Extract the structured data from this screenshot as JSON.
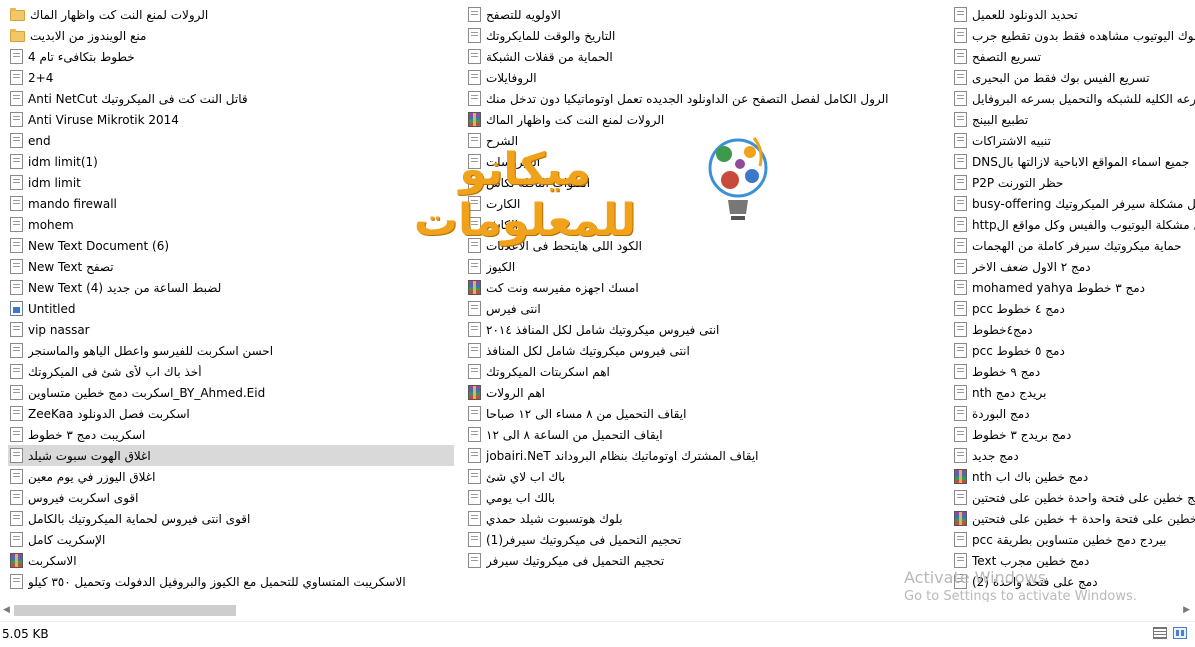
{
  "files": {
    "columns": [
      [
        {
          "name": "الرولات لمنع النت كت واظهار الماك",
          "icon": "folder-icon"
        },
        {
          "name": "منع الويندوز من الابديت",
          "icon": "folder-icon"
        },
        {
          "name": "خطوط بتكافىء تام 4",
          "icon": "text-file-icon"
        },
        {
          "name": "2+4",
          "icon": "text-file-icon"
        },
        {
          "name": "Anti NetCut قاتل النت كت فى الميكروتيك",
          "icon": "text-file-icon"
        },
        {
          "name": "Anti Viruse Mikrotik 2014",
          "icon": "text-file-icon"
        },
        {
          "name": "end",
          "icon": "text-file-icon"
        },
        {
          "name": "idm limit(1)",
          "icon": "text-file-icon"
        },
        {
          "name": "idm limit",
          "icon": "text-file-icon"
        },
        {
          "name": "mando firewall",
          "icon": "text-file-icon"
        },
        {
          "name": "mohem",
          "icon": "text-file-icon"
        },
        {
          "name": "New Text Document (6)",
          "icon": "text-file-icon"
        },
        {
          "name": "New Text تصفح",
          "icon": "text-file-icon"
        },
        {
          "name": "New Text لضبط الساعة من جديد (4)",
          "icon": "text-file-icon"
        },
        {
          "name": "Untitled",
          "icon": "image-file-icon"
        },
        {
          "name": "vip nassar",
          "icon": "text-file-icon"
        },
        {
          "name": "احسن اسكربت للفيرسو واعطل الياهو والماسنجر",
          "icon": "text-file-icon"
        },
        {
          "name": "أخذ باك اب لأى شئ فى الميكروتك",
          "icon": "text-file-icon"
        },
        {
          "name": "اسكربت دمج خطين متساوين_BY_Ahmed.Eid",
          "icon": "text-file-icon"
        },
        {
          "name": "ZeeKaa  اسكربت فصل الدونلود",
          "icon": "text-file-icon"
        },
        {
          "name": "اسكريبت دمج ٣ خطوط",
          "icon": "text-file-icon"
        },
        {
          "name": "اغلاق الهوت سبوت شيلد",
          "icon": "text-file-icon",
          "selected": true
        },
        {
          "name": "اغلاق اليوزر في يوم معين",
          "icon": "text-file-icon"
        },
        {
          "name": "اقوى اسكربت فيروس",
          "icon": "text-file-icon"
        },
        {
          "name": "اقوى انتى فيروس لحماية الميكروتيك بالكامل",
          "icon": "text-file-icon"
        },
        {
          "name": "الإسكريت كامل",
          "icon": "text-file-icon"
        },
        {
          "name": "الاسكربت",
          "icon": "rar-archive-icon"
        },
        {
          "name": "الاسكريبت المتساوي للتحميل مع الكيوز والبروفيل الدفولت وتحميل ٣٥٠ كيلو",
          "icon": "text-file-icon"
        }
      ],
      [
        {
          "name": "الاولويه للتصفح",
          "icon": "text-file-icon"
        },
        {
          "name": "التاريخ والوقت للمايكروتك",
          "icon": "text-file-icon"
        },
        {
          "name": "الحماية من قفلات الشبكة",
          "icon": "text-file-icon"
        },
        {
          "name": "الروفايلات",
          "icon": "text-file-icon"
        },
        {
          "name": "الرول الكامل لفصل التصفح عن الداونلود الجديده تعمل اوتوماتيكيا دون تدخل منك",
          "icon": "text-file-icon"
        },
        {
          "name": "الرولات لمنع النت كت واظهار الماك",
          "icon": "rar-archive-icon"
        },
        {
          "name": "الشرح",
          "icon": "text-file-icon"
        },
        {
          "name": "الفيروسات",
          "icon": "text-file-icon"
        },
        {
          "name": "القنوات الناقله لكاس",
          "icon": "text-file-icon"
        },
        {
          "name": "الكارت",
          "icon": "text-file-icon"
        },
        {
          "name": "الكاش",
          "icon": "text-file-icon"
        },
        {
          "name": "الكود اللى هايتحط فى الاعلانات",
          "icon": "text-file-icon"
        },
        {
          "name": "الكيوز",
          "icon": "text-file-icon"
        },
        {
          "name": "امسك اجهزه مفيرسه ونت كت",
          "icon": "rar-archive-icon"
        },
        {
          "name": "انتى فيرس",
          "icon": "text-file-icon"
        },
        {
          "name": "انتى فيروس ميكروتيك شامل لكل المنافذ ٢٠١٤",
          "icon": "text-file-icon"
        },
        {
          "name": "انتى فيروس ميكروتيك شامل لكل المنافذ",
          "icon": "text-file-icon"
        },
        {
          "name": "اهم  اسكربتات  الميكروتك",
          "icon": "text-file-icon"
        },
        {
          "name": "اهم الرولات",
          "icon": "rar-archive-icon"
        },
        {
          "name": "ايقاف التحميل من ٨ مساء الى ١٢ صباحا",
          "icon": "text-file-icon"
        },
        {
          "name": "ايقاف التحميل من الساعة ٨ الى ١٢",
          "icon": "text-file-icon"
        },
        {
          "name": "jobairi.NeT ايقاف المشترك اوتوماتيك بنظام البروداند",
          "icon": "text-file-icon"
        },
        {
          "name": "باك اب لاي شئ",
          "icon": "text-file-icon"
        },
        {
          "name": "بالك اب يومي",
          "icon": "text-file-icon"
        },
        {
          "name": "بلوك هوتسبوت شيلد حمدي",
          "icon": "text-file-icon"
        },
        {
          "name": "(1)تحجيم التحميل فى ميكروتيك سيرفر",
          "icon": "text-file-icon"
        },
        {
          "name": "تحجيم التحميل فى ميكروتيك سيرفر",
          "icon": "text-file-icon"
        }
      ],
      [
        {
          "name": "تحديد الدونلود للعميل",
          "icon": "text-file-icon"
        },
        {
          "name": "بوك اليوتيوب مشاهده فقط بدون تقطيع جرب",
          "icon": "text-file-icon"
        },
        {
          "name": "تسريع التصفح",
          "icon": "text-file-icon"
        },
        {
          "name": "تسريع الفيس بوك فقط من البحيرى",
          "icon": "text-file-icon"
        },
        {
          "name": "السرعه الكليه للشبكه والتحميل بسرعه البروفايل",
          "icon": "text-file-icon"
        },
        {
          "name": "تطبيع البينج",
          "icon": "text-file-icon"
        },
        {
          "name": "تنبيه الاشتراكات",
          "icon": "text-file-icon"
        },
        {
          "name": "DNSجميع اسماء المواقع الاباحية لازالتها بال",
          "icon": "text-file-icon"
        },
        {
          "name": "P2P حظر التورنت",
          "icon": "text-file-icon"
        },
        {
          "name": "busy-offering حل مشكلة سيرفر الميكروتيك",
          "icon": "text-file-icon"
        },
        {
          "name": "httpحل مشكلة اليوتيوب والفيس وكل مواقع ال",
          "icon": "text-file-icon"
        },
        {
          "name": "حماية ميكروتيك سيرفر كاملة من الهجمات",
          "icon": "text-file-icon"
        },
        {
          "name": "دمج ٢ الاول ضعف الاخر",
          "icon": "text-file-icon"
        },
        {
          "name": "mohamed yahya دمج ٣ خطوط",
          "icon": "text-file-icon"
        },
        {
          "name": "pcc دمج ٤ خطوط",
          "icon": "text-file-icon"
        },
        {
          "name": "دمج٤خطوط",
          "icon": "text-file-icon"
        },
        {
          "name": "pcc دمج ٥ خطوط",
          "icon": "text-file-icon"
        },
        {
          "name": "دمج ٩ خطوط",
          "icon": "text-file-icon"
        },
        {
          "name": "nth بريدج دمج",
          "icon": "text-file-icon"
        },
        {
          "name": "دمج البوردة",
          "icon": "text-file-icon"
        },
        {
          "name": "دمج بريدج ٣ خطوط",
          "icon": "text-file-icon"
        },
        {
          "name": "دمج جديد",
          "icon": "text-file-icon"
        },
        {
          "name": "nth دمج خطين  باك اب",
          "icon": "rar-archive-icon"
        },
        {
          "name": "دمج خطين على فتحة واحدة  خطين على فتحتين",
          "icon": "text-file-icon"
        },
        {
          "name": "دمج خطين على فتحة واحدة + خطين على فتحتين",
          "icon": "rar-archive-icon"
        },
        {
          "name": "pcc بيردج دمج خطين متساوين بطريقة",
          "icon": "text-file-icon"
        },
        {
          "name": "Text دمج خطين مجرب",
          "icon": "text-file-icon"
        },
        {
          "name": "(2) دمج على فتحة واحدة",
          "icon": "text-file-icon"
        }
      ]
    ]
  },
  "logo": {
    "text": "ميكانو للمعلومات"
  },
  "watermark": {
    "title": "Activate Windows",
    "subtitle": "Go to Settings to activate Windows."
  },
  "status": {
    "size": "5.05 KB"
  },
  "scroll": {
    "position_fraction": 0.0,
    "visible_fraction": 0.19
  }
}
